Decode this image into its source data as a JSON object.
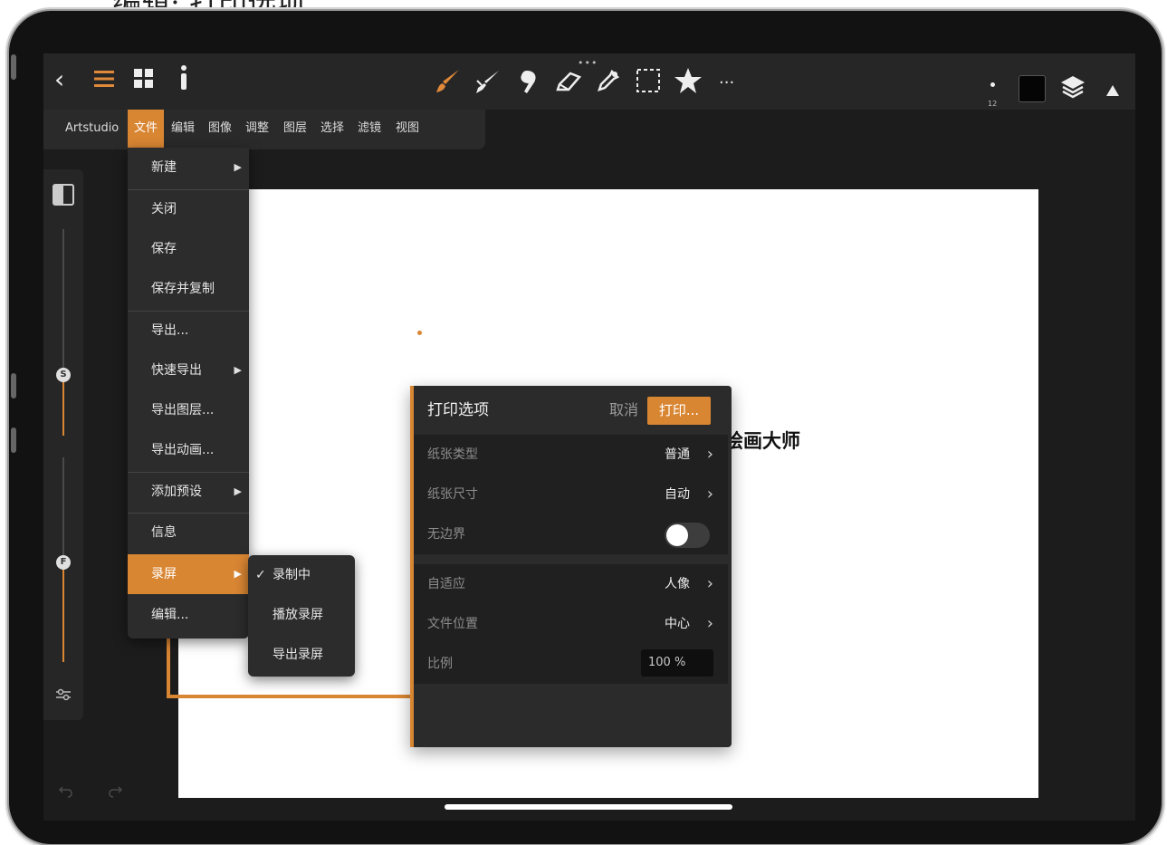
{
  "caption": "二编辑: 打印选项",
  "app": {
    "name": "Artstudio"
  },
  "menubar": {
    "items": [
      "Artstudio",
      "文件",
      "编辑",
      "图像",
      "调整",
      "图层",
      "选择",
      "滤镜",
      "视图"
    ],
    "active": "文件"
  },
  "toolbar": {
    "brush_size": "12",
    "more": "···",
    "handle": "•••"
  },
  "left_panel": {
    "slider_s_label": "S",
    "slider_f_label": "F"
  },
  "file_menu": {
    "items": [
      {
        "label": "新建",
        "submenu": true
      },
      {
        "label": "关闭"
      },
      {
        "label": "保存"
      },
      {
        "label": "保存并复制"
      },
      {
        "label": "导出..."
      },
      {
        "label": "快速导出",
        "submenu": true
      },
      {
        "label": "导出图层..."
      },
      {
        "label": "导出动画..."
      },
      {
        "label": "添加预设",
        "submenu": true
      },
      {
        "label": "信息"
      },
      {
        "label": "录屏",
        "submenu": true,
        "active": true
      },
      {
        "label": "编辑..."
      }
    ],
    "arrow": "▶"
  },
  "record_submenu": {
    "items": [
      {
        "label": "录制中",
        "checked": true
      },
      {
        "label": "播放录屏"
      },
      {
        "label": "导出录屏"
      }
    ],
    "check": "✓"
  },
  "canvas": {
    "text": "绘画大师"
  },
  "print_options": {
    "title": "打印选项",
    "cancel": "取消",
    "print": "打印...",
    "rows": [
      {
        "label": "纸张类型",
        "value": "普通"
      },
      {
        "label": "纸张尺寸",
        "value": "自动"
      },
      {
        "label": "无边界",
        "toggle": false
      },
      {
        "label": "自适应",
        "value": "人像"
      },
      {
        "label": "文件位置",
        "value": "中心"
      },
      {
        "label": "比例",
        "input": "100 %"
      }
    ]
  },
  "colors": {
    "accent": "#d98633",
    "panel": "#2b2b2b",
    "screen": "#1c1c1c"
  }
}
